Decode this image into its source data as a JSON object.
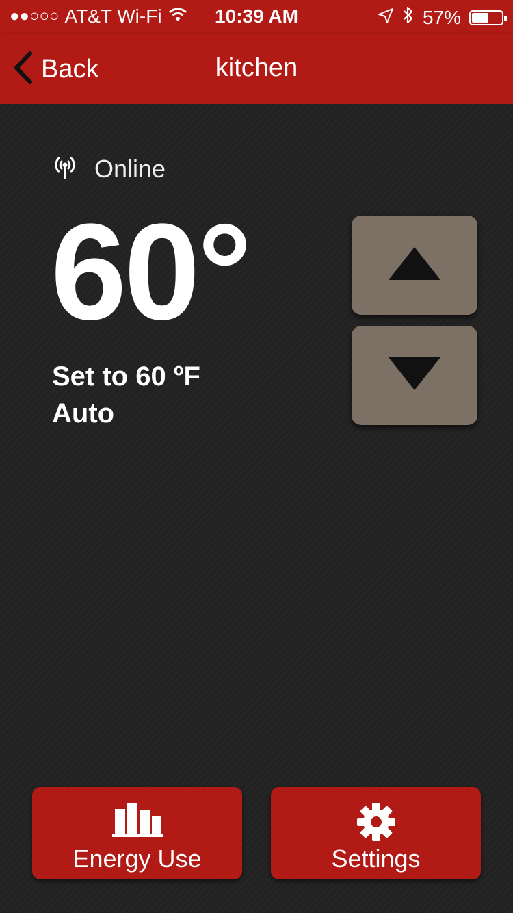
{
  "status_bar": {
    "signal": "●●○○○",
    "carrier": "AT&T Wi-Fi",
    "time": "10:39 AM",
    "battery": "57%",
    "battery_level": 0.57
  },
  "nav": {
    "back_label": "Back",
    "title": "kitchen"
  },
  "thermostat": {
    "connection_status": "Online",
    "current_temp": "60°",
    "setpoint": "Set to 60 ºF",
    "mode": "Auto"
  },
  "actions": {
    "energy_label": "Energy Use",
    "settings_label": "Settings"
  },
  "colors": {
    "brand_red": "#b21a16",
    "stepper_button": "#7d7064",
    "background": "#222222"
  },
  "icons": {
    "back": "chevron-left-icon",
    "online": "antenna-icon",
    "increase": "triangle-up-icon",
    "decrease": "triangle-down-icon",
    "energy": "bar-chart-icon",
    "settings": "gear-icon"
  }
}
